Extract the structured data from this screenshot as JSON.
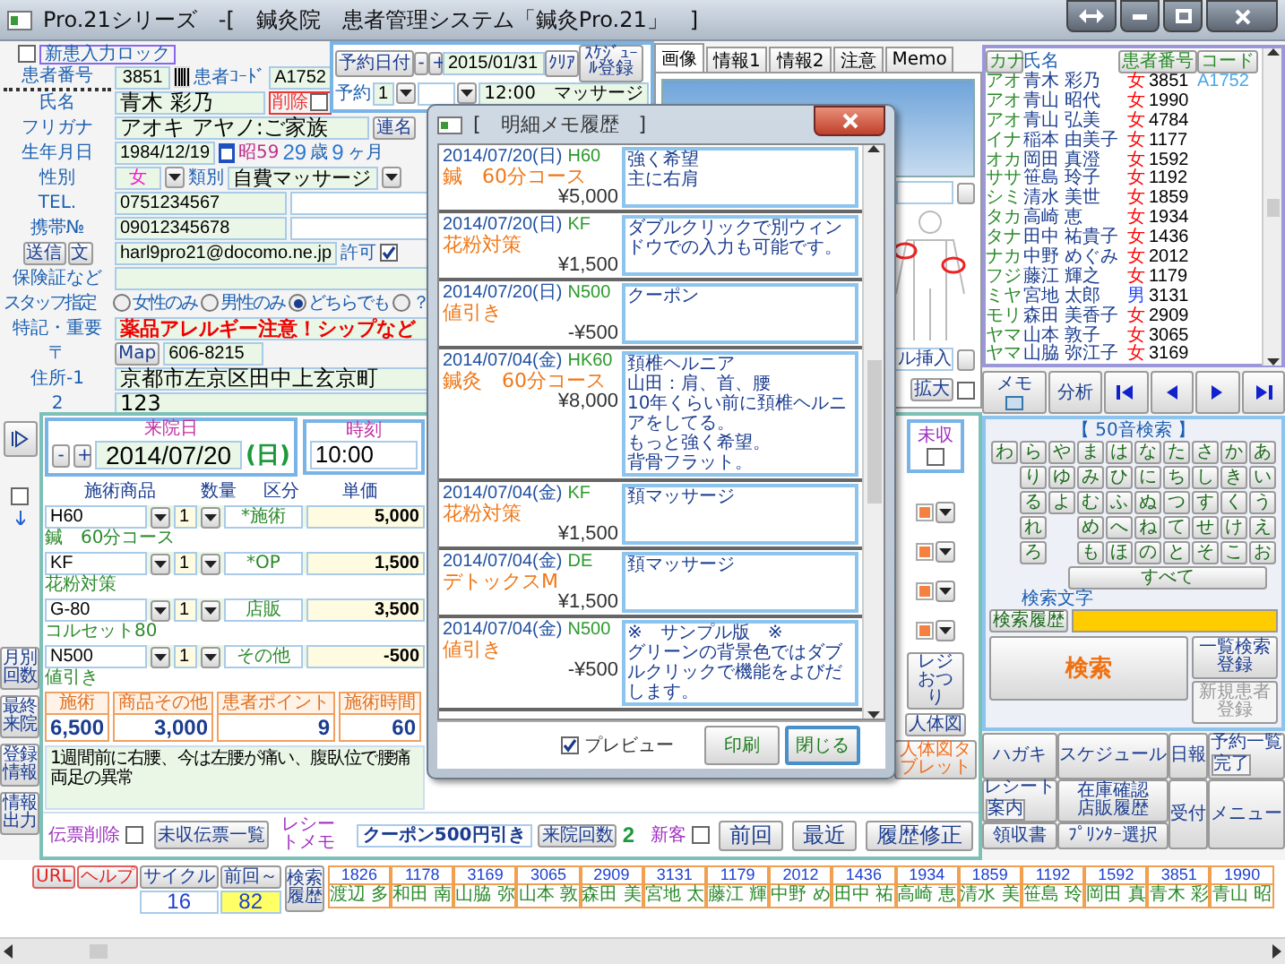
{
  "window": {
    "title": "Pro.21シリーズ　-[　鍼灸院　患者管理システム「鍼灸Pro.21」　]"
  },
  "patient": {
    "lock": {
      "label": "新患入力ロック",
      "checked": false
    },
    "number": {
      "label": "患者番号",
      "value": "3851"
    },
    "code": {
      "label": "患者ｺｰﾄﾞ",
      "value": "A1752"
    },
    "name": {
      "label": "氏名",
      "value": "青木 彩乃"
    },
    "delete": {
      "label": "削除",
      "checked": false
    },
    "furigana": {
      "label": "フリガナ",
      "value": "アオキ アヤノ:ご家族"
    },
    "joint_name_button": "連名",
    "birth": {
      "label": "生年月日",
      "value": "1984/12/19",
      "era": "昭59",
      "age": "29",
      "age_unit": "歳",
      "months": "9",
      "months_unit": "ヶ月"
    },
    "sex": {
      "label": "性別",
      "value": "女"
    },
    "category": {
      "label": "類別",
      "value": "自費マッサージ"
    },
    "tel": {
      "label": "TEL.",
      "value": "0751234567"
    },
    "mobile": {
      "label": "携帯№",
      "value": "09012345678"
    },
    "send_button": "送信",
    "text_button": "文",
    "email": {
      "value": "harl9pro21@docomo.ne.jp"
    },
    "permit": {
      "label": "許可",
      "checked": true
    },
    "insurance": {
      "label": "保険証など"
    },
    "staff": {
      "label": "スタッフ指定",
      "options": [
        {
          "label": "女性のみ",
          "selected": false
        },
        {
          "label": "男性のみ",
          "selected": false
        },
        {
          "label": "どちらでも",
          "selected": true
        },
        {
          "label": "？",
          "selected": false
        }
      ]
    },
    "notes": {
      "label": "特記・重要",
      "value": "薬品アレルギー注意！シップなど"
    },
    "zip": {
      "label": "〒",
      "map_button": "Map",
      "value": "606-8215"
    },
    "address1": {
      "label": "住所-1",
      "value": "京都市左京区田中上玄京町"
    },
    "address2": {
      "label": "2",
      "value": "123"
    }
  },
  "reservation": {
    "date_button": "予約日付",
    "minus": "-",
    "plus": "+",
    "date": "2015/01/31",
    "clear_button": "ｸﾘｱ",
    "schedule_button": "ｽｹｼﾞｭｰﾙ登録",
    "slot_label": "予約",
    "slot": "1",
    "entry": "12:00　マッサージ"
  },
  "image_panel": {
    "tabs": [
      {
        "label": "画像",
        "selected": true
      },
      {
        "label": "情報1",
        "selected": false
      },
      {
        "label": "情報2",
        "selected": false
      },
      {
        "label": "注意",
        "selected": false
      },
      {
        "label": "Memo",
        "selected": false
      }
    ],
    "field_text": "ル挿入",
    "zoom_button": "拡大",
    "zoom_check": {
      "checked": false
    }
  },
  "patient_list": {
    "columns": [
      {
        "label": "カナ",
        "kind": "button"
      },
      {
        "label": "氏名",
        "kind": "label"
      },
      {
        "label": "患者番号",
        "kind": "button"
      },
      {
        "label": "コード",
        "kind": "button"
      }
    ],
    "rows": [
      {
        "kana": "アオ",
        "name": "青木 彩乃",
        "sex": "女",
        "color": "#ff0000",
        "number": "3851",
        "code": "A1752"
      },
      {
        "kana": "アオ",
        "name": "青山 昭代",
        "sex": "女",
        "color": "#ff0000",
        "number": "1990"
      },
      {
        "kana": "アオ",
        "name": "青山 弘美",
        "sex": "女",
        "color": "#ff0000",
        "number": "4784"
      },
      {
        "kana": "イナ",
        "name": "稲本 由美子",
        "sex": "女",
        "color": "#ff0000",
        "number": "1177"
      },
      {
        "kana": "オカ",
        "name": "岡田 真澄",
        "sex": "女",
        "color": "#ff0000",
        "number": "1592"
      },
      {
        "kana": "ササ",
        "name": "笹島 玲子",
        "sex": "女",
        "color": "#ff0000",
        "number": "1192"
      },
      {
        "kana": "シミ",
        "name": "清水 美世",
        "sex": "女",
        "color": "#ff0000",
        "number": "1859"
      },
      {
        "kana": "タカ",
        "name": "高崎 恵",
        "sex": "女",
        "color": "#ff0000",
        "number": "1934"
      },
      {
        "kana": "タナ",
        "name": "田中 祐貴子",
        "sex": "女",
        "color": "#ff0000",
        "number": "1436"
      },
      {
        "kana": "ナカ",
        "name": "中野 めぐみ",
        "sex": "女",
        "color": "#ff0000",
        "number": "2012"
      },
      {
        "kana": "フジ",
        "name": "藤江 輝之",
        "sex": "女",
        "color": "#ff0000",
        "number": "1179"
      },
      {
        "kana": "ミヤ",
        "name": "宮地 太郎",
        "sex": "男",
        "color": "#2040ff",
        "number": "3131"
      },
      {
        "kana": "モリ",
        "name": "森田 美香子",
        "sex": "女",
        "color": "#ff0000",
        "number": "2909"
      },
      {
        "kana": "ヤマ",
        "name": "山本 敦子",
        "sex": "女",
        "color": "#ff0000",
        "number": "3065"
      },
      {
        "kana": "ヤマ",
        "name": "山脇 弥江子",
        "sex": "女",
        "color": "#ff0000",
        "number": "3169"
      }
    ],
    "memo_button": "メモ",
    "analysis_button": "分析"
  },
  "kana_search": {
    "title": "【 50音検索 】",
    "columns": [
      [
        "わ"
      ],
      [
        "ら",
        "り",
        "る",
        "れ",
        "ろ"
      ],
      [
        "や",
        "ゆ",
        "よ"
      ],
      [
        "ま",
        "み",
        "む",
        "め",
        "も"
      ],
      [
        "は",
        "ひ",
        "ふ",
        "へ",
        "ほ"
      ],
      [
        "な",
        "に",
        "ぬ",
        "ね",
        "の"
      ],
      [
        "た",
        "ち",
        "つ",
        "て",
        "と"
      ],
      [
        "さ",
        "し",
        "す",
        "せ",
        "そ"
      ],
      [
        "か",
        "き",
        "く",
        "け",
        "こ"
      ],
      [
        "あ",
        "い",
        "う",
        "え",
        "お"
      ]
    ],
    "all_button": "すべて",
    "search_text_label": "検索文字",
    "history_button": "検索履歴",
    "search_button": "検索",
    "list_register_button": "一覧検索登録",
    "new_patient_button": {
      "label": "新規患者登録",
      "disabled": true
    }
  },
  "commands": [
    {
      "label": "ハガキ"
    },
    {
      "label": "スケジュール"
    },
    {
      "label": "日報"
    },
    {
      "label": "予約一覧",
      "sub": "完了"
    },
    {
      "label": "レシート",
      "sub": "案内"
    },
    {
      "label": "在庫確認店販履歴"
    },
    {
      "label": "受付"
    },
    {
      "label": "メニュー"
    },
    {
      "label": "領収書"
    },
    {
      "label": "ﾌﾟﾘﾝﾀｰ選択"
    }
  ],
  "side_check": {
    "checked": false
  },
  "side_buttons": [
    "月別回数",
    "最終来院",
    "登録情報",
    "情報出力"
  ],
  "visit": {
    "date_label": "来院日",
    "minus": "-",
    "plus": "+",
    "date": "2014/07/20",
    "weekday": "(日)",
    "time_label": "時刻",
    "time": "10:00",
    "unpaid": {
      "label": "未収",
      "checked": false
    },
    "columns": [
      "施術商品",
      "数量",
      "区分",
      "単価"
    ],
    "items": [
      {
        "code": "H60",
        "qty": "1",
        "category": "*施術",
        "price": "5,000",
        "name": "鍼　60分コース"
      },
      {
        "code": "KF",
        "qty": "1",
        "category": "*OP",
        "price": "1,500",
        "name": "花粉対策"
      },
      {
        "code": "G-80",
        "qty": "1",
        "category": "店販",
        "price": "3,500",
        "name": "コルセット80"
      },
      {
        "code": "N500",
        "qty": "1",
        "category": "その他",
        "price": "-500",
        "name": "値引き"
      }
    ],
    "totals": [
      {
        "label": "施術",
        "value": "6,500"
      },
      {
        "label": "商品その他",
        "value": "3,000"
      },
      {
        "label": "患者ポイント",
        "value": "9"
      },
      {
        "label": "施術時間",
        "value": "60"
      }
    ],
    "memo": [
      "1週間前に右腰、今は左腰が痛い、腹臥位で腰痛",
      "両足の異常"
    ],
    "register_button": "レジおつり",
    "body_button": "人体図",
    "body_tablet_button": "人体図タブレット",
    "slip_delete": {
      "label": "伝票削除",
      "checked": false
    },
    "unpaid_list_button": "未収伝票一覧",
    "receipt_memo_label": "レシートメモ",
    "receipt_memo": "クーポン500円引き",
    "visits_button": "来院回数",
    "visits": "2",
    "new_customer": {
      "label": "新客",
      "checked": false
    },
    "buttons": [
      "前回",
      "最近",
      "履歴修正"
    ]
  },
  "recent": {
    "url_button": "URL",
    "help_button": "ヘルプ",
    "cycle_button": "サイクル",
    "last_button": "前回～",
    "cycle": "16",
    "last": "82",
    "history_button": "検索履歴",
    "patients": [
      {
        "number": "1826",
        "name": "渡辺 多"
      },
      {
        "number": "1178",
        "name": "和田 南"
      },
      {
        "number": "3169",
        "name": "山脇 弥"
      },
      {
        "number": "3065",
        "name": "山本 敦"
      },
      {
        "number": "2909",
        "name": "森田 美"
      },
      {
        "number": "3131",
        "name": "宮地 太"
      },
      {
        "number": "1179",
        "name": "藤江 輝"
      },
      {
        "number": "2012",
        "name": "中野 め"
      },
      {
        "number": "1436",
        "name": "田中 祐"
      },
      {
        "number": "1934",
        "name": "高崎 恵"
      },
      {
        "number": "1859",
        "name": "清水 美"
      },
      {
        "number": "1192",
        "name": "笹島 玲"
      },
      {
        "number": "1592",
        "name": "岡田 真"
      },
      {
        "number": "3851",
        "name": "青木 彩"
      },
      {
        "number": "1990",
        "name": "青山 昭"
      }
    ]
  },
  "dialog": {
    "title": "[　明細メモ履歴　]",
    "entries": [
      {
        "date": "2014/07/20(日)",
        "code": "H60",
        "item": "鍼　60分コース",
        "price": "¥5,000",
        "memo": [
          "強く希望",
          "主に右肩"
        ]
      },
      {
        "date": "2014/07/20(日)",
        "code": "KF",
        "item": "花粉対策",
        "price": "¥1,500",
        "memo": [
          "ダブルクリックで別ウィンドウでの入力も可能です。"
        ]
      },
      {
        "date": "2014/07/20(日)",
        "code": "N500",
        "item": "値引き",
        "price": "-¥500",
        "memo": [
          "クーポン"
        ]
      },
      {
        "date": "2014/07/04(金)",
        "code": "HK60",
        "item": "鍼灸　60分コース",
        "price": "¥8,000",
        "memo": [
          "頚椎ヘルニア",
          "山田：肩、首、腰",
          "10年くらい前に頚椎ヘルニアをしてる。",
          "もっと強く希望。",
          "背骨フラット。"
        ]
      },
      {
        "date": "2014/07/04(金)",
        "code": "KF",
        "item": "花粉対策",
        "price": "¥1,500",
        "memo": [
          "頚マッサージ"
        ]
      },
      {
        "date": "2014/07/04(金)",
        "code": "DE",
        "item": "デトックスM",
        "price": "¥1,500",
        "memo": [
          "頚マッサージ"
        ]
      },
      {
        "date": "2014/07/04(金)",
        "code": "N500",
        "item": "値引き",
        "price": "-¥500",
        "memo": [
          "※　サンプル版　※",
          "グリーンの背景色ではダブルクリックで機能をよびだします。"
        ]
      }
    ],
    "preview": {
      "label": "プレビュー",
      "checked": true
    },
    "print_button": "印刷",
    "close_button": "閉じる"
  }
}
